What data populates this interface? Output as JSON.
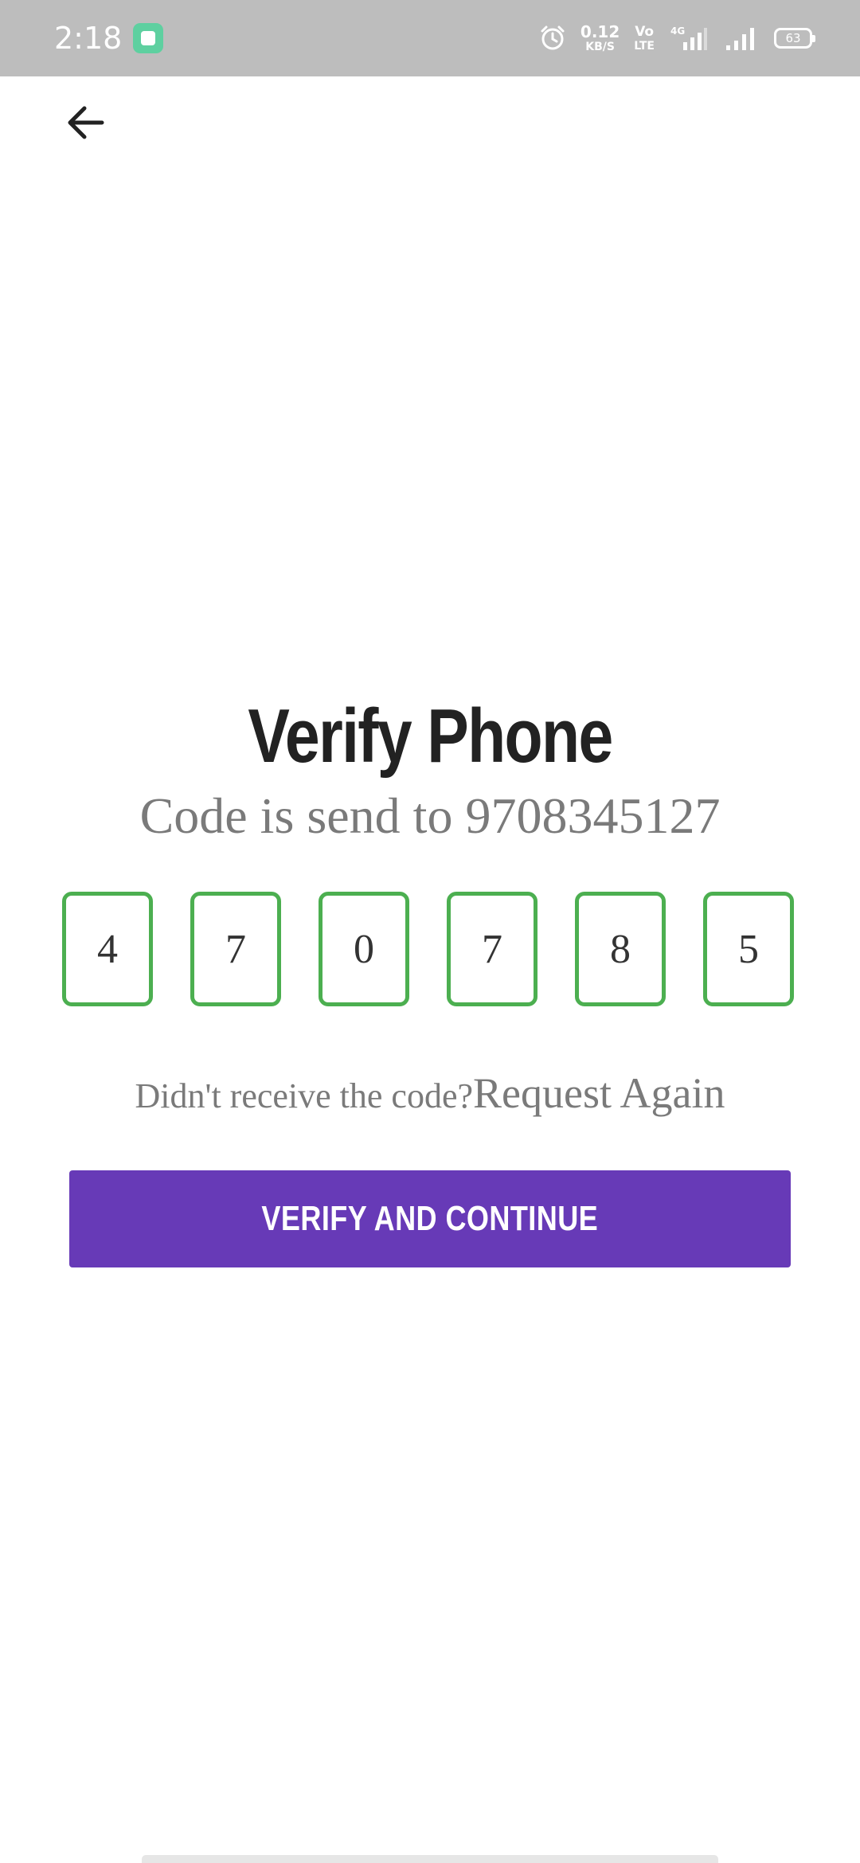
{
  "status_bar": {
    "time": "2:18",
    "net_speed_value": "0.12",
    "net_speed_unit": "KB/S",
    "volte_top": "Vo",
    "volte_bottom": "LTE",
    "battery": "63"
  },
  "header": {
    "back_icon": "arrow-left-icon"
  },
  "main": {
    "title": "Verify Phone",
    "subtitle": "Code is send to 9708345127",
    "otp_digits": [
      "4",
      "7",
      "0",
      "7",
      "8",
      "5"
    ],
    "resend_prompt": "Didn't receive the code?",
    "resend_link": "Request Again",
    "verify_button_label": "VERIFY AND CONTINUE"
  },
  "colors": {
    "status_bar_bg": "#bdbdbd",
    "otp_border": "#4caf50",
    "button_bg": "#673ab7",
    "title_text": "#222222",
    "muted_text": "#7a7a7a"
  }
}
